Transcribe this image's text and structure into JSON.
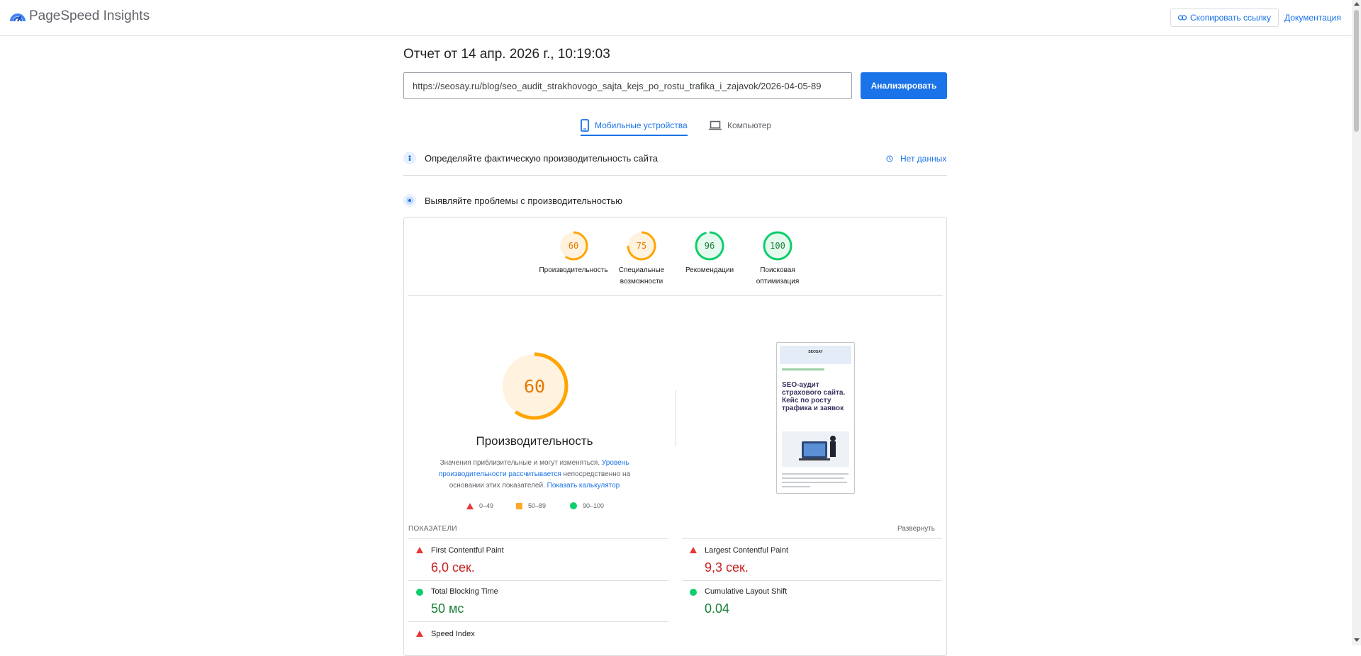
{
  "header": {
    "app_title": "PageSpeed Insights",
    "copy_link_label": "Скопировать ссылку",
    "docs_label": "Документация",
    "brand_color": "#1a73e8"
  },
  "report": {
    "title": "Отчет от 14 апр. 2026 г., 10:19:03",
    "url_value": "https://seosay.ru/blog/seo_audit_strakhovogo_sajta_kejs_po_rostu_trafika_i_zajavok/2026-04-05-89",
    "analyze_label": "Анализировать"
  },
  "tabs": [
    {
      "label": "Мобильные устройства",
      "icon": "smartphone-icon",
      "active": true
    },
    {
      "label": "Компьютер",
      "icon": "laptop-icon",
      "active": false
    }
  ],
  "field_section": {
    "title": "Определяйте фактическую производительность сайта",
    "status": "Нет данных"
  },
  "lab_section": {
    "title": "Выявляйте проблемы с производительностью"
  },
  "categories": [
    {
      "score": "60",
      "label": "Производительность",
      "color": "#ffa400"
    },
    {
      "score": "75",
      "label": "Специальные возможности",
      "color": "#ffa400"
    },
    {
      "score": "96",
      "label": "Рекомендации",
      "color": "#0cce6b"
    },
    {
      "score": "100",
      "label": "Поисковая оптимизация",
      "color": "#0cce6b"
    }
  ],
  "performance": {
    "score": "60",
    "label": "Производительность",
    "disclaimer_pre": "Значения приблизительные и могут изменяться. ",
    "disclaimer_link1": "Уровень производительности рассчитывается",
    "disclaimer_mid": " непосредственно на основании этих показателей. ",
    "disclaimer_link2": "Показать калькулятор",
    "legend": [
      {
        "range": "0–49",
        "shape": "triangle",
        "color": "#e53935"
      },
      {
        "range": "50–89",
        "shape": "square",
        "color": "#ffa726"
      },
      {
        "range": "90–100",
        "shape": "circle",
        "color": "#0cce6b"
      }
    ]
  },
  "screenshot": {
    "brand": "SEOSAY",
    "title": "SEO-аудит страхового сайта. Кейс по росту трафика и заявок"
  },
  "metrics": {
    "heading": "ПОКАЗАТЕЛИ",
    "expand_label": "Развернуть",
    "items": [
      {
        "name": "First Contentful Paint",
        "value": "6,0 сек.",
        "status": "fail",
        "color": "#c5221f"
      },
      {
        "name": "Largest Contentful Paint",
        "value": "9,3 сек.",
        "status": "fail",
        "color": "#c5221f"
      },
      {
        "name": "Total Blocking Time",
        "value": "50 мс",
        "status": "pass",
        "color": "#188038"
      },
      {
        "name": "Cumulative Layout Shift",
        "value": "0.04",
        "status": "pass",
        "color": "#188038"
      },
      {
        "name": "Speed Index",
        "value": "",
        "status": "fail",
        "color": "#c5221f"
      }
    ]
  }
}
